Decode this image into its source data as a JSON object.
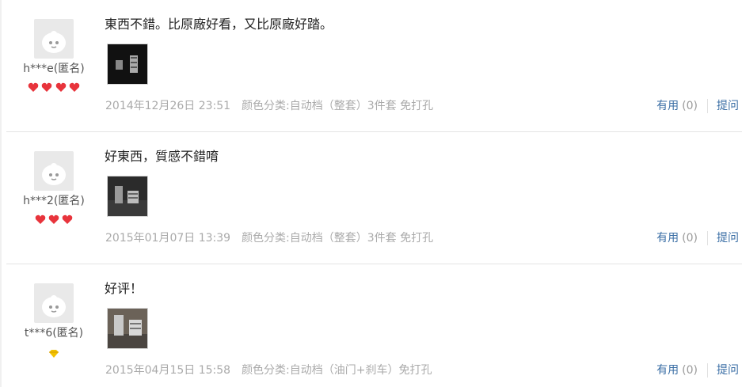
{
  "reviews": [
    {
      "username": "h***e(匿名)",
      "content": "東西不錯。比原廠好看，又比原廠好踏。",
      "date": "2014年12月26日 23:51",
      "spec": "颜色分类:自动档（整套）3件套 免打孔",
      "useful_label": "有用",
      "useful_count": "(0)",
      "reply_label": "提问",
      "rank_icon": "red-heart-icon"
    },
    {
      "username": "h***2(匿名)",
      "content": "好東西，質感不錯唷",
      "date": "2015年01月07日 13:39",
      "spec": "颜色分类:自动档（整套）3件套 免打孔",
      "useful_label": "有用",
      "useful_count": "(0)",
      "reply_label": "提问",
      "rank_icon": "red-heart-icon"
    },
    {
      "username": "t***6(匿名)",
      "content": "好评！",
      "date": "2015年04月15日 15:58",
      "spec": "颜色分类:自动档（油门+刹车）免打孔",
      "useful_label": "有用",
      "useful_count": "(0)",
      "reply_label": "提问",
      "rank_icon": "yellow-diamond-icon"
    }
  ],
  "colors": {
    "link": "#3a6ea5",
    "meta": "#aaaaaa",
    "heart": "#e8343c",
    "diamond": "#f2c200"
  }
}
